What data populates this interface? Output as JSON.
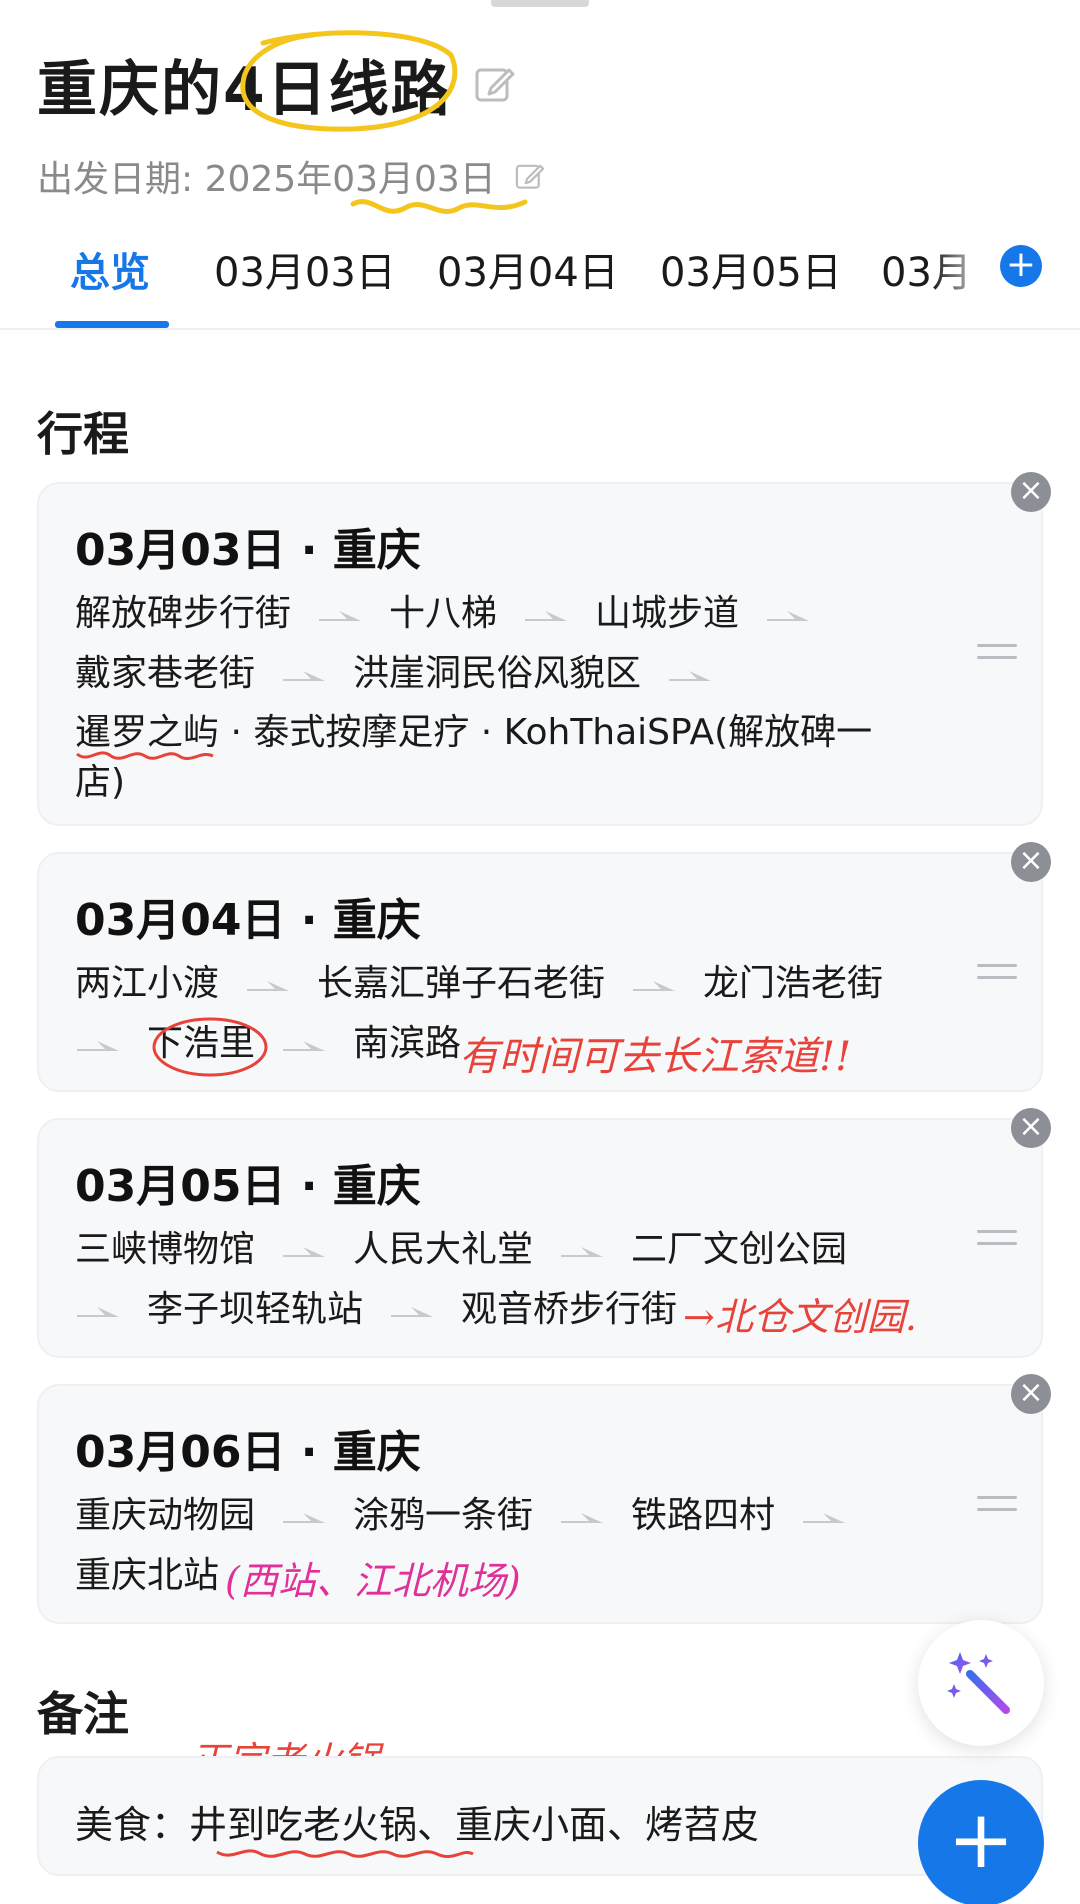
{
  "header": {
    "title": "重庆的4日线路",
    "date_label": "出发日期: 2025年03月03日"
  },
  "tabs": [
    {
      "label": "总览",
      "active": true
    },
    {
      "label": "03月03日"
    },
    {
      "label": "03月04日"
    },
    {
      "label": "03月05日"
    },
    {
      "label": "03月"
    }
  ],
  "itinerary": {
    "section_title": "行程",
    "days": [
      {
        "title": "03月03日 · 重庆",
        "places": [
          "解放碑步行街",
          "十八梯",
          "山城步道",
          "戴家巷老街",
          "洪崖洞民俗风貌区",
          "暹罗之屿 · 泰式按摩足疗 · KohThaiSPA(解放碑一店)"
        ]
      },
      {
        "title": "03月04日 · 重庆",
        "places": [
          "两江小渡",
          "长嘉汇弹子石老街",
          "龙门浩老街",
          "下浩里",
          "南滨路"
        ],
        "annotation": "有时间可去长江索道!!"
      },
      {
        "title": "03月05日 · 重庆",
        "places": [
          "三峡博物馆",
          "人民大礼堂",
          "二厂文创公园",
          "李子坝轻轨站",
          "观音桥步行街"
        ],
        "annotation": "→北仓文创园."
      },
      {
        "title": "03月06日 · 重庆",
        "places": [
          "重庆动物园",
          "涂鸦一条街",
          "铁路四村",
          "重庆北站"
        ],
        "annotation": "(西站、江北机场)"
      }
    ]
  },
  "notes": {
    "section_title": "备注",
    "text": "美食：井到吃老火锅、重庆小面、烤苕皮",
    "annotation": "正宗老火锅"
  },
  "colors": {
    "accent": "#1677e8",
    "annot_red": "#e8433b",
    "annot_pink": "#e0309a",
    "highlight_yellow": "#f4c51c"
  },
  "icons": [
    "edit-icon",
    "plus-icon",
    "close-icon",
    "drag-handle-icon",
    "magic-wand-icon",
    "arrow-right-icon"
  ]
}
